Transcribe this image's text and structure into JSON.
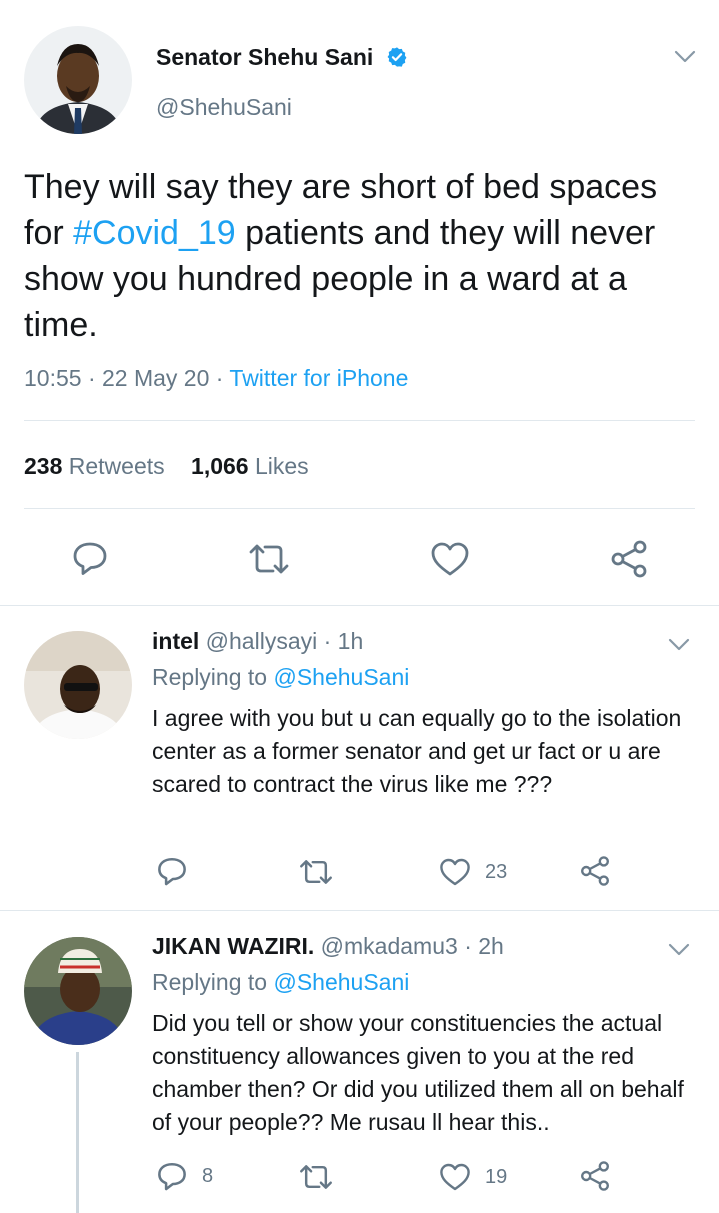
{
  "main_tweet": {
    "author_name": "Senator Shehu Sani",
    "handle": "@ShehuSani",
    "text_before": "They will say they are short of bed spaces for ",
    "hashtag": "#Covid_19",
    "text_after": " patients and they will never show you hundred people in a ward at a time.",
    "time_date": "10:55 · 22 May 20 · ",
    "source": "Twitter for iPhone",
    "retweets_count": "238",
    "retweets_label": "Retweets",
    "likes_count": "1,066",
    "likes_label": "Likes"
  },
  "replies": [
    {
      "author_name": "intel",
      "handle": "@hallysayi",
      "age": "· 1h",
      "replying_prefix": "Replying to ",
      "replying_to": "@ShehuSani",
      "text": "I agree with you but u can equally go to the isolation center as a former senator and get ur fact or u are scared to contract the virus like me ???",
      "reply_count": "",
      "retweet_count": "",
      "like_count": "23"
    },
    {
      "author_name": "JIKAN WAZIRI.",
      "handle": "@mkadamu3",
      "age": "· 2h",
      "replying_prefix": "Replying to ",
      "replying_to": "@ShehuSani",
      "text": "Did you tell or show your constituencies the actual constituency allowances given to you at the red chamber then? Or did you utilized them all on behalf of your people?? Me rusau ll hear this..",
      "reply_count": "8",
      "retweet_count": "",
      "like_count": "19"
    }
  ],
  "colors": {
    "accent": "#1da1f2",
    "secondary_text": "#657786",
    "verified_badge": "#1da1f2",
    "divider": "#e1e8ed",
    "icon": "#657786"
  },
  "icons": [
    "verified-badge-icon",
    "chevron-down-icon",
    "reply-icon",
    "retweet-icon",
    "like-icon",
    "share-icon"
  ]
}
